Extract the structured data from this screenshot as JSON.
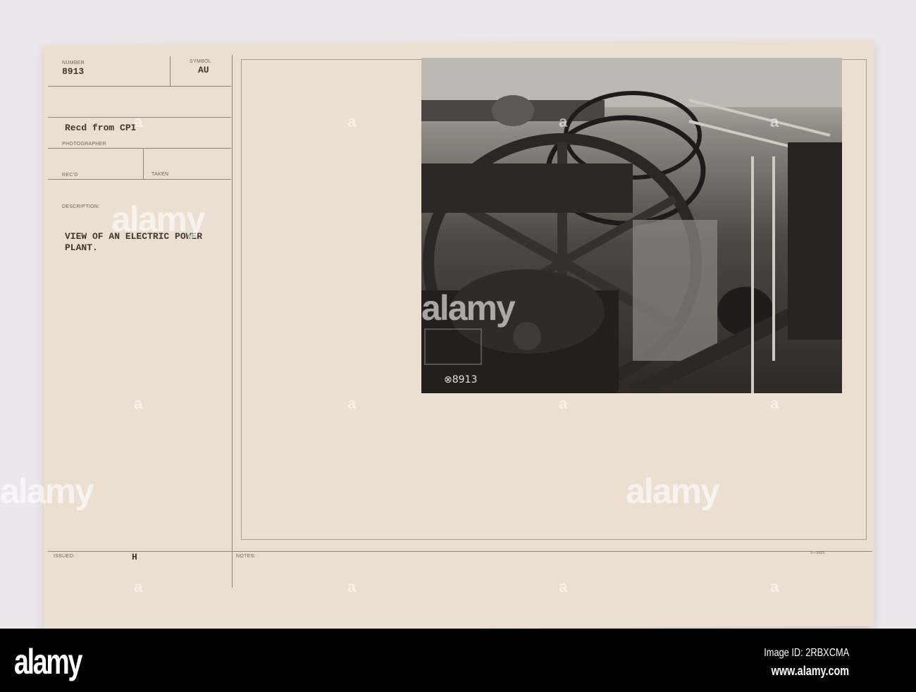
{
  "card": {
    "number_label": "NUMBER",
    "number": "8913",
    "symbol_label": "SYMBOL",
    "symbol": "AU",
    "source": "Recd from CPI",
    "photographer_label": "PHOTOGRAPHER",
    "recd_label": "REC'D",
    "taken_label": "TAKEN",
    "description_label": "DESCRIPTION:",
    "description_line1": "VIEW OF AN ELECTRIC POWER",
    "description_line2": "PLANT.",
    "issued_label": "ISSUED:",
    "issued": "H",
    "notes_label": "NOTES:",
    "form_number": "5—3005"
  },
  "photo": {
    "negative_number": "⊗8913"
  },
  "watermark": {
    "text": "alamy",
    "image_id": "Image ID: 2RBXCMA",
    "url": "www.alamy.com"
  }
}
